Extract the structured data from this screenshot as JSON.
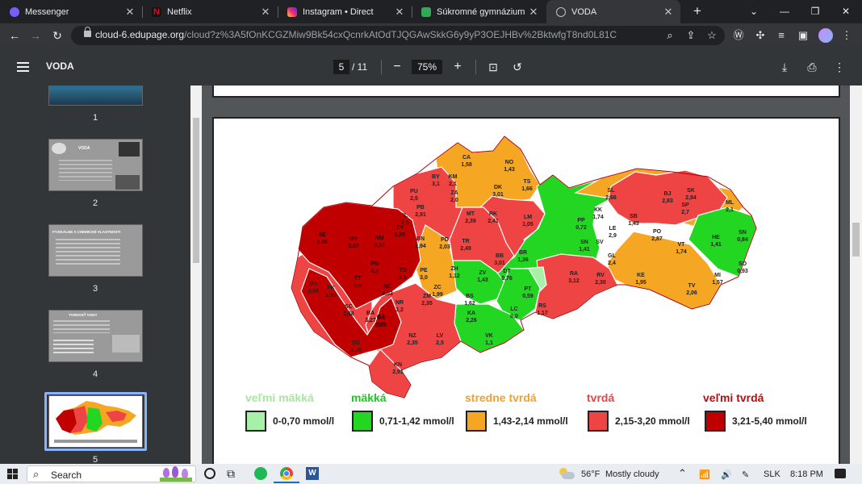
{
  "tabs": [
    {
      "title": "Messenger",
      "icon": "messenger-icon",
      "color": "#7b5cff"
    },
    {
      "title": "Netflix",
      "icon": "netflix-icon",
      "color": "#e50914"
    },
    {
      "title": "Instagram • Direct",
      "icon": "instagram-icon",
      "color": "#e1306c"
    },
    {
      "title": "Súkromné gymnázium Ba",
      "icon": "edupage-icon",
      "color": "#34a853"
    },
    {
      "title": "VODA",
      "icon": "globe-icon",
      "color": "#9aa0a6"
    }
  ],
  "address": {
    "host": "cloud-6.edupage.org",
    "path": "/cloud?z%3A5fOnKCGZMiw9Bk54cxQcnrkAtOdTJQGAwSkkG6y9yP3OEJHBv%2BktwfgT8nd0L81C"
  },
  "viewer": {
    "title": "VODA",
    "page": "5",
    "total": "/ 11",
    "zoom": "75%"
  },
  "thumbnails": [
    {
      "num": "1"
    },
    {
      "num": "2",
      "title": "VODA"
    },
    {
      "num": "3",
      "title": "FYZIKÁLNE A CHEMICKÉ VLASTNOSTI"
    },
    {
      "num": "4",
      "title": "TVRDOSŤ VODY"
    },
    {
      "num": "5"
    }
  ],
  "map": {
    "districts": [
      {
        "code": "CA",
        "value": "1,58",
        "level": 3
      },
      {
        "code": "NO",
        "value": "1,43",
        "level": 3
      },
      {
        "code": "BY",
        "value": "3,1",
        "level": 4
      },
      {
        "code": "KM",
        "value": "2,1",
        "level": 3
      },
      {
        "code": "ZA",
        "value": "2,0",
        "level": 3
      },
      {
        "code": "DK",
        "value": "3,01",
        "level": 4
      },
      {
        "code": "TS",
        "value": "1,66",
        "level": 3
      },
      {
        "code": "PU",
        "value": "2,5",
        "level": 4
      },
      {
        "code": "PB",
        "value": "2,91",
        "level": 4
      },
      {
        "code": "IL",
        "value": "2,5",
        "level": 4
      },
      {
        "code": "MT",
        "value": "2,39",
        "level": 4
      },
      {
        "code": "RK",
        "value": "2,41",
        "level": 4
      },
      {
        "code": "LM",
        "value": "1,05",
        "level": 2
      },
      {
        "code": "PP",
        "value": "0,72",
        "level": 2
      },
      {
        "code": "SL",
        "value": "2,66",
        "level": 4
      },
      {
        "code": "BJ",
        "value": "2,83",
        "level": 4
      },
      {
        "code": "SK",
        "value": "2,84",
        "level": 4
      },
      {
        "code": "SP",
        "value": "2,7",
        "level": 4
      },
      {
        "code": "ML",
        "value": "2,1",
        "level": 3
      },
      {
        "code": "KK",
        "value": "1,74",
        "level": 3
      },
      {
        "code": "SB",
        "value": "1,43",
        "level": 3
      },
      {
        "code": "LE",
        "value": "2,9",
        "level": 4
      },
      {
        "code": "PO",
        "value": "2,87",
        "level": 4
      },
      {
        "code": "SV",
        "value": "",
        "level": 2
      },
      {
        "code": "SN",
        "value": "0,84",
        "level": 2
      },
      {
        "code": "HE",
        "value": "1,41",
        "level": 2
      },
      {
        "code": "VT",
        "value": "1,74",
        "level": 3
      },
      {
        "code": "SN",
        "value": "1,41",
        "level": 2
      },
      {
        "code": "GL",
        "value": "2,4",
        "level": 4
      },
      {
        "code": "SO",
        "value": "0,93",
        "level": 2
      },
      {
        "code": "KE",
        "value": "1,95",
        "level": 3
      },
      {
        "code": "MI",
        "value": "1,57",
        "level": 3
      },
      {
        "code": "TV",
        "value": "2,06",
        "level": 3
      },
      {
        "code": "SE",
        "value": "3,26",
        "level": 5
      },
      {
        "code": "MY",
        "value": "3,07",
        "level": 5
      },
      {
        "code": "NM",
        "value": "3,37",
        "level": 5
      },
      {
        "code": "TN",
        "value": "3,25",
        "level": 5
      },
      {
        "code": "BN",
        "value": "2,94",
        "level": 4
      },
      {
        "code": "PD",
        "value": "2,03",
        "level": 3
      },
      {
        "code": "TR",
        "value": "2,49",
        "level": 4
      },
      {
        "code": "BB",
        "value": "3,01",
        "level": 4
      },
      {
        "code": "BR",
        "value": "1,36",
        "level": 2
      },
      {
        "code": "RA",
        "value": "3,12",
        "level": 4
      },
      {
        "code": "RV",
        "value": "2,30",
        "level": 4
      },
      {
        "code": "MA",
        "value": "3,06",
        "level": 4
      },
      {
        "code": "PK",
        "value": "2,83",
        "level": 4
      },
      {
        "code": "SC",
        "value": "2,68",
        "level": 4
      },
      {
        "code": "TT",
        "value": "3,5",
        "level": 5
      },
      {
        "code": "PN",
        "value": "4,2",
        "level": 5
      },
      {
        "code": "TO",
        "value": "3,5",
        "level": 5
      },
      {
        "code": "PE",
        "value": "3,0",
        "level": 4
      },
      {
        "code": "NC",
        "value": "4,03",
        "level": 5
      },
      {
        "code": "BA",
        "value": "3,27",
        "level": 5
      },
      {
        "code": "GA",
        "value": "3,5",
        "level": 5
      },
      {
        "code": "ZC",
        "value": "1,99",
        "level": 3
      },
      {
        "code": "ZH",
        "value": "1,12",
        "level": 2
      },
      {
        "code": "ZV",
        "value": "1,43",
        "level": 3
      },
      {
        "code": "DT",
        "value": "0,76",
        "level": 2
      },
      {
        "code": "PT",
        "value": "0,59",
        "level": 1
      },
      {
        "code": "BS",
        "value": "1,62",
        "level": 3
      },
      {
        "code": "ZM",
        "value": "2,35",
        "level": 4
      },
      {
        "code": "NR",
        "value": "3,2",
        "level": 4
      },
      {
        "code": "KA",
        "value": "2,26",
        "level": 4
      },
      {
        "code": "LC",
        "value": "0,0",
        "level": 2
      },
      {
        "code": "RS",
        "value": "1,17",
        "level": 2
      },
      {
        "code": "VK",
        "value": "1,1",
        "level": 2
      },
      {
        "code": "LV",
        "value": "2,5",
        "level": 4
      },
      {
        "code": "DS",
        "value": "2,75",
        "level": 4
      },
      {
        "code": "NZ",
        "value": "2,35",
        "level": 4
      },
      {
        "code": "KN",
        "value": "2,91",
        "level": 4
      },
      {
        "code": "SA",
        "value": "3,08",
        "level": 5
      }
    ]
  },
  "legend": [
    {
      "title": "veľmi mäkká",
      "range": "0-0,70 mmol/l",
      "color": "#a8f0a8",
      "title_color": "#a8e6a0"
    },
    {
      "title": "mäkká",
      "range": "0,71-1,42 mmol/l",
      "color": "#22d622",
      "title_color": "#22c422"
    },
    {
      "title": "stredne tvrdá",
      "range": "1,43-2,14 mmol/l",
      "color": "#f5a623",
      "title_color": "#f0a030"
    },
    {
      "title": "tvrdá",
      "range": "2,15-3,20 mmol/l",
      "color": "#ee4444",
      "title_color": "#e04848"
    },
    {
      "title": "veľmi tvrdá",
      "range": "3,21-5,40 mmol/l",
      "color": "#c00000",
      "title_color": "#b01010"
    }
  ],
  "taskbar": {
    "search": "Search",
    "weather": "56°F",
    "weather_desc": "Mostly cloudy",
    "lang": "SLK",
    "time": "8:18 PM"
  }
}
